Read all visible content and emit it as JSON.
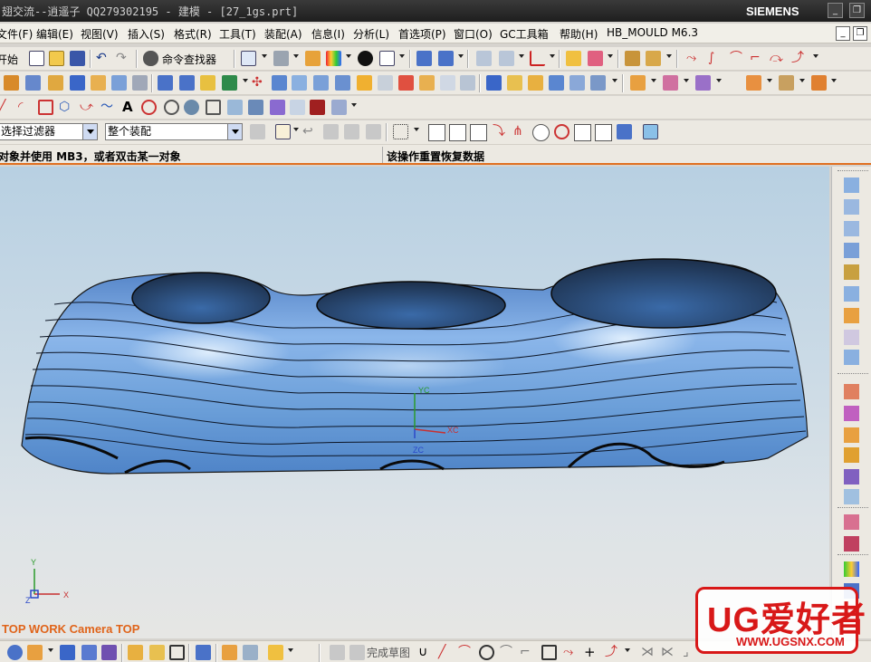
{
  "window": {
    "title": "翅交流--逍遥子 QQ279302195 - 建模 - [27_1gs.prt]",
    "brand": "SIEMENS",
    "minimize_label": "_",
    "restore_label": "❐"
  },
  "menu": {
    "items": [
      "文件(F)",
      "编辑(E)",
      "视图(V)",
      "插入(S)",
      "格式(R)",
      "工具(T)",
      "装配(A)",
      "信息(I)",
      "分析(L)",
      "首选项(P)",
      "窗口(O)",
      "GC工具箱",
      "帮助(H)",
      "HB_MOULD M6.3"
    ],
    "mdi_minimize": "_",
    "mdi_restore": "❐"
  },
  "toolbar": {
    "start_label": "开始",
    "command_finder_label": "命令查找器"
  },
  "selection_bar": {
    "filter_value": "选择过滤器",
    "scope_value": "整个装配"
  },
  "cue": {
    "left_text": "对象并使用 MB3，或者双击某一对象",
    "right_text": "该操作重置恢复数据"
  },
  "viewport": {
    "view_label": "TOP WORK Camera TOP",
    "csys_labels": {
      "xc": "XC",
      "yc": "YC",
      "zc": "ZC"
    },
    "triad_labels": {
      "x": "X",
      "y": "Y",
      "z": "Z"
    }
  },
  "bottom_toolbar": {
    "finish_sketch_label": "完成草图"
  },
  "watermark": {
    "title": "UG爱好者",
    "url": "WWW.UGSNX.COM"
  },
  "colors": {
    "accent": "#e0641a",
    "model_blue": "#6a9ed8",
    "watermark_red": "#d81818"
  }
}
